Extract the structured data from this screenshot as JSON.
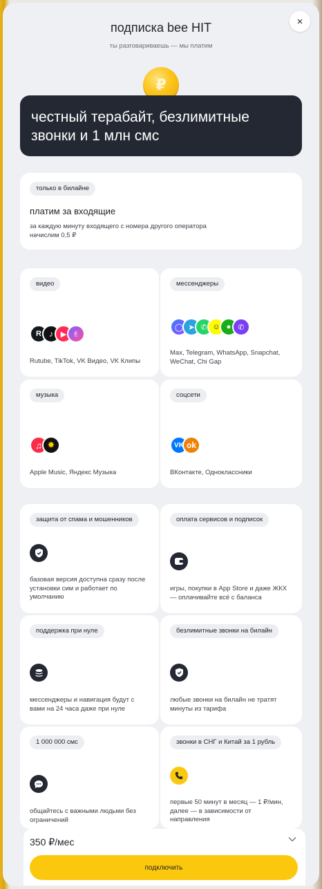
{
  "header": {
    "title": "подписка bee HIT",
    "subtitle": "ты разговариваешь — мы платим",
    "close_label": "×",
    "coin_symbol": "₽"
  },
  "hero": {
    "text": "честный терабайт, безлимитные звонки и 1 млн смс"
  },
  "incoming": {
    "chip": "только в билайне",
    "title": "платим за входящие",
    "desc": "за каждую минуту входящего с номера другого оператора начислим 0,5 ₽"
  },
  "apps": {
    "video": {
      "chip": "видео",
      "desc": "Rutube, TikTok, VK Видео, VK Клипы",
      "icons": [
        "rutube-icon",
        "tiktok-icon",
        "vk-video-icon",
        "vk-clips-icon"
      ]
    },
    "messengers": {
      "chip": "мессенджеры",
      "desc": "Max, Telegram, WhatsApp, Snapchat, WeChat, Chi Gap",
      "icons": [
        "max-icon",
        "telegram-icon",
        "whatsapp-icon",
        "snapchat-icon",
        "wechat-icon",
        "chi-gap-icon"
      ]
    },
    "music": {
      "chip": "музыка",
      "desc": "Apple Music, Яндекс Музыка",
      "icons": [
        "apple-music-icon",
        "yandex-music-icon"
      ]
    },
    "social": {
      "chip": "соцсети",
      "desc": "ВКонтакте, Одноклассники",
      "icons": [
        "vk-icon",
        "odnoklassniki-icon"
      ]
    }
  },
  "features": [
    {
      "chip": "защита от спама и мошенников",
      "desc": "базовая версия доступна сразу после установки сим и работает по умолчанию",
      "icon": "shield-icon"
    },
    {
      "chip": "оплата сервисов и подписок",
      "desc": "игры, покупки в App Store и даже ЖКХ — оплачивайте всё с баланса",
      "icon": "wallet-icon"
    },
    {
      "chip": "поддержка при нуле",
      "desc": "мессенджеры и навигация будут с вами на 24 часа даже при нуле",
      "icon": "coins-icon"
    },
    {
      "chip": "безлимитные звонки на билайн",
      "desc": "любые звонки на билайн не тратят минуты из тарифа",
      "icon": "shield-check-icon"
    },
    {
      "chip": "1 000 000 смс",
      "desc": "общайтесь с важными людьми без ограничений",
      "icon": "chat-icon"
    },
    {
      "chip": "звонки в СНГ и Китай за 1 рубль",
      "desc": "первые 50 минут в месяц — 1 ₽/мин, далее — в зависимости от направления",
      "icon": "phone-icon"
    }
  ],
  "footer": {
    "price": "350 ₽/мес",
    "button": "подключить"
  },
  "colors": {
    "accent": "#fcc80e",
    "dark": "#232833",
    "background": "#eef0f3"
  }
}
